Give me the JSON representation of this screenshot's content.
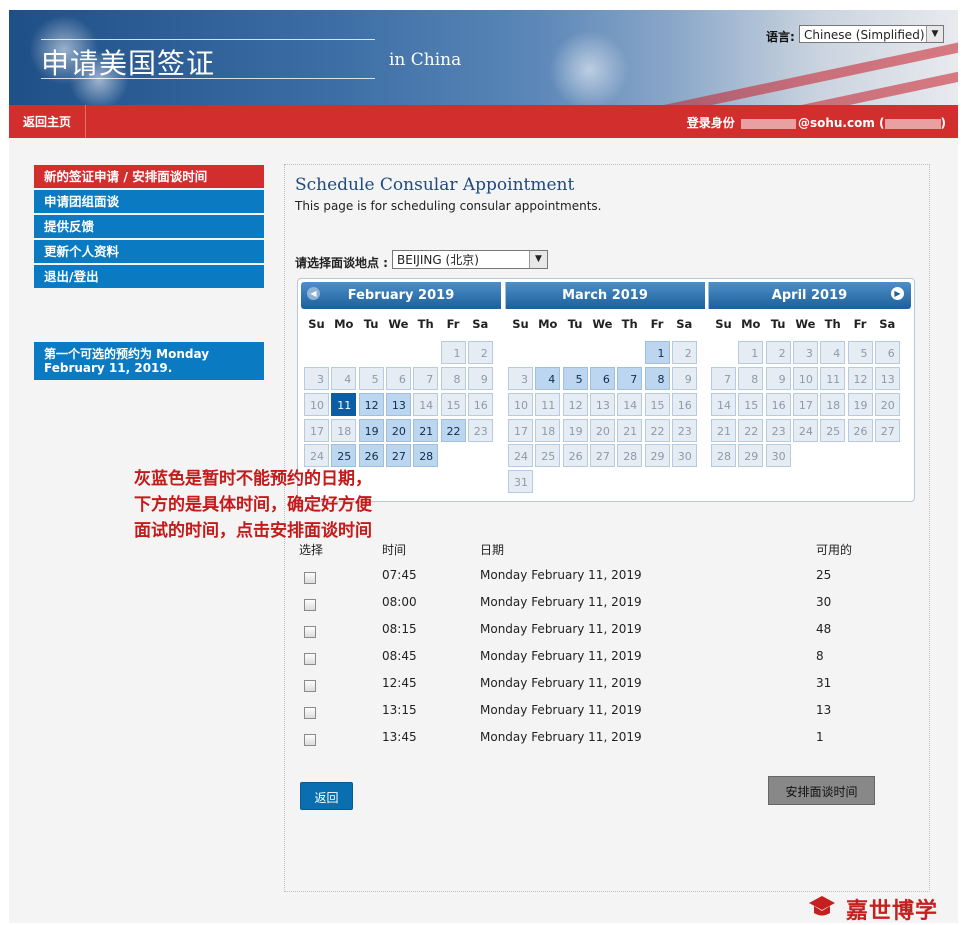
{
  "header": {
    "site_title": "申请美国签证",
    "location_suffix": "in China",
    "language_label": "语言:",
    "language_value": "Chinese (Simplified)"
  },
  "topbar": {
    "home_link": "返回主页",
    "login_label": "登录身份",
    "login_email_suffix": "@sohu.com (",
    "login_close": ")"
  },
  "sidebar": {
    "items": [
      {
        "label": "新的签证申请 / 安排面谈时间",
        "active": true
      },
      {
        "label": "申请团组面谈",
        "active": false
      },
      {
        "label": "提供反馈",
        "active": false
      },
      {
        "label": "更新个人资料",
        "active": false
      },
      {
        "label": "退出/登出",
        "active": false
      }
    ],
    "first_available": "第一个可选的预约为 Monday February 11, 2019."
  },
  "main": {
    "title": "Schedule Consular Appointment",
    "subtitle": "This page is for scheduling consular appointments.",
    "post_label": "请选择面谈地点 :",
    "post_value": "BEIJING (北京)"
  },
  "calendar": {
    "weekdays": [
      "Su",
      "Mo",
      "Tu",
      "We",
      "Th",
      "Fr",
      "Sa"
    ],
    "months": [
      {
        "title": "February 2019",
        "first_weekday": 5,
        "days": 28,
        "available": [
          11,
          12,
          13,
          19,
          20,
          21,
          22,
          25,
          26,
          27,
          28
        ],
        "selected": 11,
        "has_prev": true,
        "has_next": false
      },
      {
        "title": "March 2019",
        "first_weekday": 5,
        "days": 31,
        "available": [
          1,
          4,
          5,
          6,
          7,
          8
        ],
        "selected": null,
        "has_prev": false,
        "has_next": false
      },
      {
        "title": "April 2019",
        "first_weekday": 1,
        "days": 30,
        "available": [],
        "selected": null,
        "has_prev": false,
        "has_next": true
      }
    ]
  },
  "annotation": {
    "lines": [
      "灰蓝色是暂时不能预约的日期，",
      "下方的是具体时间，确定好方便",
      "面试的时间，点击安排面谈时间"
    ]
  },
  "slots": {
    "headers": {
      "select": "选择",
      "time": "时间",
      "date": "日期",
      "available": "可用的"
    },
    "rows": [
      {
        "time": "07:45",
        "date": "Monday February 11, 2019",
        "available": "25"
      },
      {
        "time": "08:00",
        "date": "Monday February 11, 2019",
        "available": "30"
      },
      {
        "time": "08:15",
        "date": "Monday February 11, 2019",
        "available": "48"
      },
      {
        "time": "08:45",
        "date": "Monday February 11, 2019",
        "available": "8"
      },
      {
        "time": "12:45",
        "date": "Monday February 11, 2019",
        "available": "31"
      },
      {
        "time": "13:15",
        "date": "Monday February 11, 2019",
        "available": "13"
      },
      {
        "time": "13:45",
        "date": "Monday February 11, 2019",
        "available": "1"
      }
    ]
  },
  "buttons": {
    "back": "返回",
    "schedule": "安排面谈时间"
  },
  "watermark": {
    "text": "嘉世博学"
  },
  "colors": {
    "brand_red": "#d32e2e",
    "nav_blue": "#0a7bc2",
    "available_day": "#bcd6ef",
    "selected_day": "#0b5ea3",
    "unavailable_day": "#e6ecf3",
    "annotation_red": "#c41a1a"
  }
}
